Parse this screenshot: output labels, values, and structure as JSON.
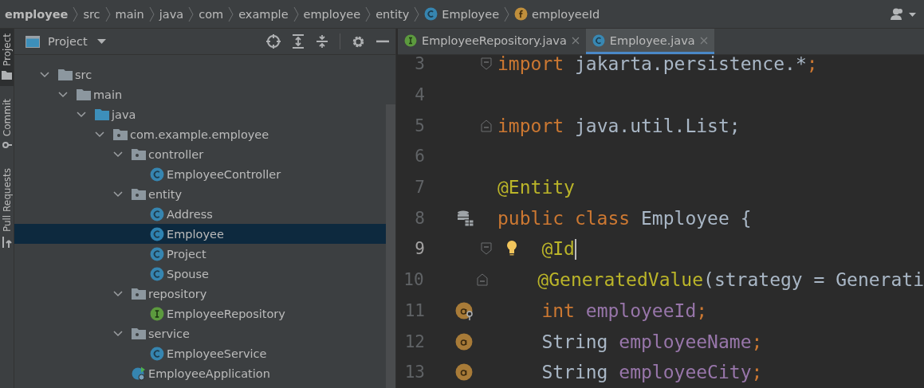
{
  "breadcrumbs": [
    {
      "label": "employee",
      "kind": "project"
    },
    {
      "label": "src",
      "kind": "folder"
    },
    {
      "label": "main",
      "kind": "folder"
    },
    {
      "label": "java",
      "kind": "folder"
    },
    {
      "label": "com",
      "kind": "folder"
    },
    {
      "label": "example",
      "kind": "folder"
    },
    {
      "label": "employee",
      "kind": "folder"
    },
    {
      "label": "entity",
      "kind": "folder"
    },
    {
      "label": "Employee",
      "kind": "class"
    },
    {
      "label": "employeeId",
      "kind": "field"
    }
  ],
  "tool_strip": [
    {
      "label": "Project",
      "selected": true
    },
    {
      "label": "Commit",
      "selected": false
    },
    {
      "label": "Pull Requests",
      "selected": false
    }
  ],
  "project_panel": {
    "title": "Project",
    "tree": [
      {
        "label": "src",
        "kind": "folder",
        "expanded": true,
        "selected": false,
        "children": [
          {
            "label": "main",
            "kind": "folder",
            "expanded": true,
            "selected": false,
            "children": [
              {
                "label": "java",
                "kind": "source-folder",
                "expanded": true,
                "selected": false,
                "children": [
                  {
                    "label": "com.example.employee",
                    "kind": "package",
                    "expanded": true,
                    "selected": false,
                    "children": [
                      {
                        "label": "controller",
                        "kind": "package",
                        "expanded": true,
                        "selected": false,
                        "children": [
                          {
                            "label": "EmployeeController",
                            "kind": "class",
                            "selected": false
                          }
                        ]
                      },
                      {
                        "label": "entity",
                        "kind": "package",
                        "expanded": true,
                        "selected": false,
                        "children": [
                          {
                            "label": "Address",
                            "kind": "class",
                            "selected": false
                          },
                          {
                            "label": "Employee",
                            "kind": "class",
                            "selected": true
                          },
                          {
                            "label": "Project",
                            "kind": "class",
                            "selected": false
                          },
                          {
                            "label": "Spouse",
                            "kind": "class",
                            "selected": false
                          }
                        ]
                      },
                      {
                        "label": "repository",
                        "kind": "package",
                        "expanded": true,
                        "selected": false,
                        "children": [
                          {
                            "label": "EmployeeRepository",
                            "kind": "interface",
                            "selected": false
                          }
                        ]
                      },
                      {
                        "label": "service",
                        "kind": "package",
                        "expanded": true,
                        "selected": false,
                        "children": [
                          {
                            "label": "EmployeeService",
                            "kind": "class",
                            "selected": false
                          }
                        ]
                      },
                      {
                        "label": "EmployeeApplication",
                        "kind": "app",
                        "selected": false
                      }
                    ]
                  }
                ]
              }
            ]
          }
        ]
      }
    ]
  },
  "editor_tabs": [
    {
      "label": "EmployeeRepository.java",
      "kind": "interface",
      "selected": false
    },
    {
      "label": "Employee.java",
      "kind": "class",
      "selected": true
    }
  ],
  "code_lines": [
    {
      "number": "3",
      "current": false,
      "fold": {
        "kind": "start"
      },
      "tokens": [
        {
          "text": "import",
          "kind": "keyword"
        },
        {
          "text": " jakarta.persistence.*",
          "kind": "plain"
        },
        {
          "text": ";",
          "kind": "keyword"
        }
      ]
    },
    {
      "number": "4",
      "current": false
    },
    {
      "number": "5",
      "current": false,
      "fold": {
        "kind": "end"
      },
      "tokens": [
        {
          "text": "import",
          "kind": "keyword"
        },
        {
          "text": " java.util.List;",
          "kind": "plain"
        }
      ]
    },
    {
      "number": "6",
      "current": false
    },
    {
      "number": "7",
      "current": false,
      "tokens": [
        {
          "text": "@Entity",
          "kind": "annotation"
        }
      ]
    },
    {
      "number": "8",
      "current": false,
      "gutter": {
        "kind": "entity"
      },
      "tokens": [
        {
          "text": "public class",
          "kind": "keyword"
        },
        {
          "text": " Employee {",
          "kind": "plain"
        }
      ]
    },
    {
      "number": "9",
      "current": true,
      "fold": {
        "kind": "start"
      },
      "hint": true,
      "tokens": [
        {
          "text": "    @Id",
          "kind": "annotation"
        }
      ]
    },
    {
      "number": "10",
      "current": false,
      "fold": {
        "kind": "end"
      },
      "tokens": [
        {
          "text": "    @GeneratedValue",
          "kind": "annotation"
        },
        {
          "text": "(strategy = Generati",
          "kind": "plain"
        }
      ]
    },
    {
      "number": "11",
      "current": false,
      "gutter": {
        "kind": "id-field"
      },
      "tokens": [
        {
          "text": "    int ",
          "kind": "keyword"
        },
        {
          "text": "employeeId",
          "kind": "field"
        },
        {
          "text": ";",
          "kind": "keyword"
        }
      ]
    },
    {
      "number": "12",
      "current": false,
      "gutter": {
        "kind": "field"
      },
      "tokens": [
        {
          "text": "    String ",
          "kind": "plain"
        },
        {
          "text": "employeeName",
          "kind": "field"
        },
        {
          "text": ";",
          "kind": "keyword"
        }
      ]
    },
    {
      "number": "13",
      "current": false,
      "gutter": {
        "kind": "field"
      },
      "tokens": [
        {
          "text": "    String ",
          "kind": "plain"
        },
        {
          "text": "employeeCity",
          "kind": "field"
        },
        {
          "text": ";",
          "kind": "keyword"
        }
      ]
    }
  ]
}
